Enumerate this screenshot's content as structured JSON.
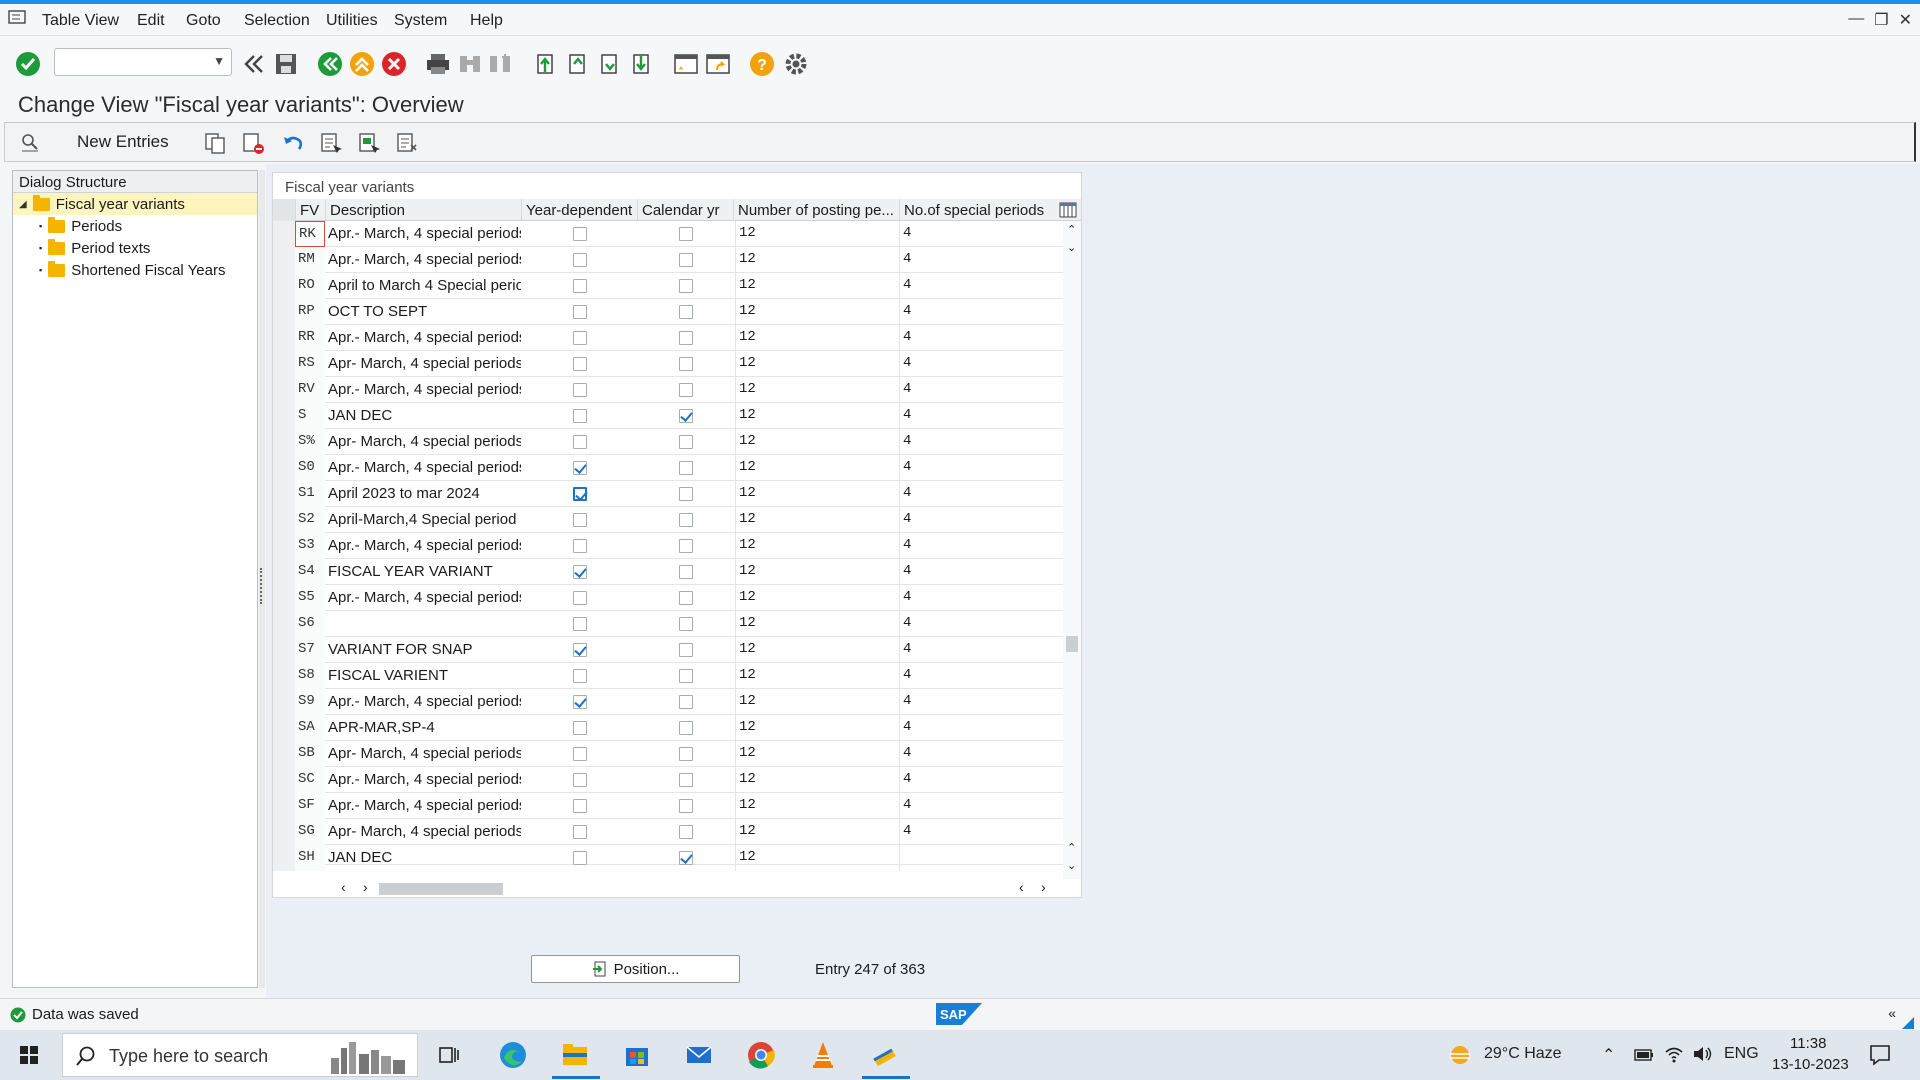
{
  "menubar": {
    "items": [
      "Table View",
      "Edit",
      "Goto",
      "Selection",
      "Utilities",
      "System",
      "Help"
    ]
  },
  "title": "Change View \"Fiscal year variants\": Overview",
  "toolbar2": {
    "new_entries": "New Entries"
  },
  "dialog_structure": {
    "header": "Dialog Structure",
    "root": "Fiscal year variants",
    "children": [
      "Periods",
      "Period texts",
      "Shortened Fiscal Years"
    ]
  },
  "table": {
    "title": "Fiscal year variants",
    "columns": [
      "FV",
      "Description",
      "Year-dependent",
      "Calendar yr",
      "Number of posting pe...",
      "No.of special periods"
    ],
    "rows": [
      {
        "fv": "RK",
        "desc": "Apr.- March, 4 special periods",
        "yd": false,
        "cy": false,
        "np": "12",
        "sp": "4"
      },
      {
        "fv": "RM",
        "desc": "Apr.- March, 4 special periods",
        "yd": false,
        "cy": false,
        "np": "12",
        "sp": "4"
      },
      {
        "fv": "RO",
        "desc": "April to March 4 Special perio",
        "yd": false,
        "cy": false,
        "np": "12",
        "sp": "4"
      },
      {
        "fv": "RP",
        "desc": "OCT TO SEPT",
        "yd": false,
        "cy": false,
        "np": "12",
        "sp": "4"
      },
      {
        "fv": "RR",
        "desc": "Apr.- March, 4 special periods",
        "yd": false,
        "cy": false,
        "np": "12",
        "sp": "4"
      },
      {
        "fv": "RS",
        "desc": "Apr- March, 4 special periods",
        "yd": false,
        "cy": false,
        "np": "12",
        "sp": "4"
      },
      {
        "fv": "RV",
        "desc": "Apr.- March, 4 special periods",
        "yd": false,
        "cy": false,
        "np": "12",
        "sp": "4"
      },
      {
        "fv": "S",
        "desc": "JAN DEC",
        "yd": false,
        "cy": true,
        "np": "12",
        "sp": "4"
      },
      {
        "fv": "S%",
        "desc": "Apr- March, 4 special periods",
        "yd": false,
        "cy": false,
        "np": "12",
        "sp": "4"
      },
      {
        "fv": "S0",
        "desc": "Apr.- March, 4 special periods",
        "yd": true,
        "cy": false,
        "np": "12",
        "sp": "4"
      },
      {
        "fv": "S1",
        "desc": "April 2023 to mar 2024",
        "yd": true,
        "cy": false,
        "np": "12",
        "sp": "4"
      },
      {
        "fv": "S2",
        "desc": "April-March,4 Special period",
        "yd": false,
        "cy": false,
        "np": "12",
        "sp": "4"
      },
      {
        "fv": "S3",
        "desc": "Apr.- March, 4 special periods",
        "yd": false,
        "cy": false,
        "np": "12",
        "sp": "4"
      },
      {
        "fv": "S4",
        "desc": "FISCAL YEAR VARIANT",
        "yd": true,
        "cy": false,
        "np": "12",
        "sp": "4"
      },
      {
        "fv": "S5",
        "desc": "Apr.- March, 4 special periods",
        "yd": false,
        "cy": false,
        "np": "12",
        "sp": "4"
      },
      {
        "fv": "S6",
        "desc": "",
        "yd": false,
        "cy": false,
        "np": "12",
        "sp": "4"
      },
      {
        "fv": "S7",
        "desc": "VARIANT FOR SNAP",
        "yd": true,
        "cy": false,
        "np": "12",
        "sp": "4"
      },
      {
        "fv": "S8",
        "desc": "FISCAL VARIENT",
        "yd": false,
        "cy": false,
        "np": "12",
        "sp": "4"
      },
      {
        "fv": "S9",
        "desc": "Apr.- March, 4 special periods",
        "yd": true,
        "cy": false,
        "np": "12",
        "sp": "4"
      },
      {
        "fv": "SA",
        "desc": "APR-MAR,SP-4",
        "yd": false,
        "cy": false,
        "np": "12",
        "sp": "4"
      },
      {
        "fv": "SB",
        "desc": "Apr- March, 4 special periods",
        "yd": false,
        "cy": false,
        "np": "12",
        "sp": "4"
      },
      {
        "fv": "SC",
        "desc": "Apr.- March, 4 special periods",
        "yd": false,
        "cy": false,
        "np": "12",
        "sp": "4"
      },
      {
        "fv": "SF",
        "desc": "Apr.- March, 4 special periods",
        "yd": false,
        "cy": false,
        "np": "12",
        "sp": "4"
      },
      {
        "fv": "SG",
        "desc": "Apr- March, 4 special periods",
        "yd": false,
        "cy": false,
        "np": "12",
        "sp": "4"
      },
      {
        "fv": "SH",
        "desc": "JAN DEC",
        "yd": false,
        "cy": true,
        "np": "12",
        "sp": ""
      }
    ]
  },
  "position_button": "Position...",
  "entry_text": "Entry 247 of 363",
  "status": {
    "message": "Data was saved"
  },
  "taskbar": {
    "search_placeholder": "Type here to search",
    "weather": "29°C  Haze",
    "lang": "ENG",
    "time": "11:38",
    "date": "13-10-2023"
  }
}
